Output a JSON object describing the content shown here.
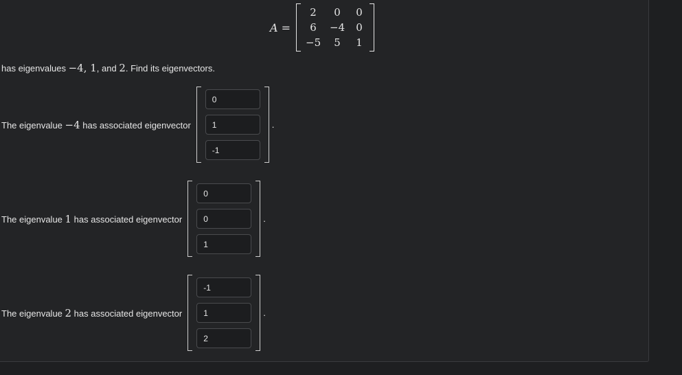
{
  "matrix": {
    "lhs": "A",
    "eq": "=",
    "rows": [
      [
        "2",
        "0",
        "0"
      ],
      [
        "6",
        "−4",
        "0"
      ],
      [
        "−5",
        "5",
        "1"
      ]
    ]
  },
  "intro": {
    "pre": "has eigenvalues ",
    "v1": "−4",
    "c1": ", ",
    "v2": "1",
    "c2": ", and ",
    "v3": "2",
    "post": ". Find its eigenvectors."
  },
  "eigen": [
    {
      "pre": "The eigenvalue ",
      "value": "−4",
      "post": " has associated eigenvector",
      "vector": [
        "0",
        "1",
        "-1"
      ],
      "period": "."
    },
    {
      "pre": "The eigenvalue ",
      "value": "1",
      "post": " has associated eigenvector",
      "vector": [
        "0",
        "0",
        "1"
      ],
      "period": "."
    },
    {
      "pre": "The eigenvalue ",
      "value": "2",
      "post": " has associated eigenvector",
      "vector": [
        "-1",
        "1",
        "2"
      ],
      "period": "."
    }
  ]
}
